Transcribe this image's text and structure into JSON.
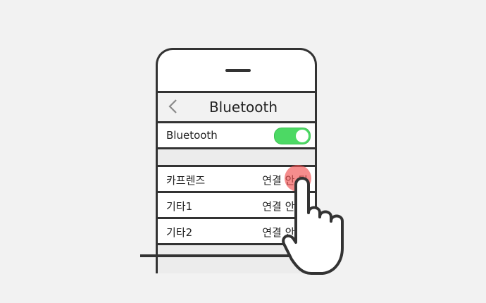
{
  "nav": {
    "title": "Bluetooth",
    "back_icon": "chevron-left-icon"
  },
  "bluetooth_row": {
    "label": "Bluetooth",
    "toggle_on": true,
    "toggle_color": "#4cd964"
  },
  "devices": [
    {
      "name": "카프렌즈",
      "status": "연결 안 됨"
    },
    {
      "name": "기타1",
      "status": "연결 안 됨"
    },
    {
      "name": "기타2",
      "status": "연결 안 됨"
    }
  ],
  "overlay": {
    "hand_icon": "pointing-hand-icon",
    "tap_color": "#f05050"
  }
}
